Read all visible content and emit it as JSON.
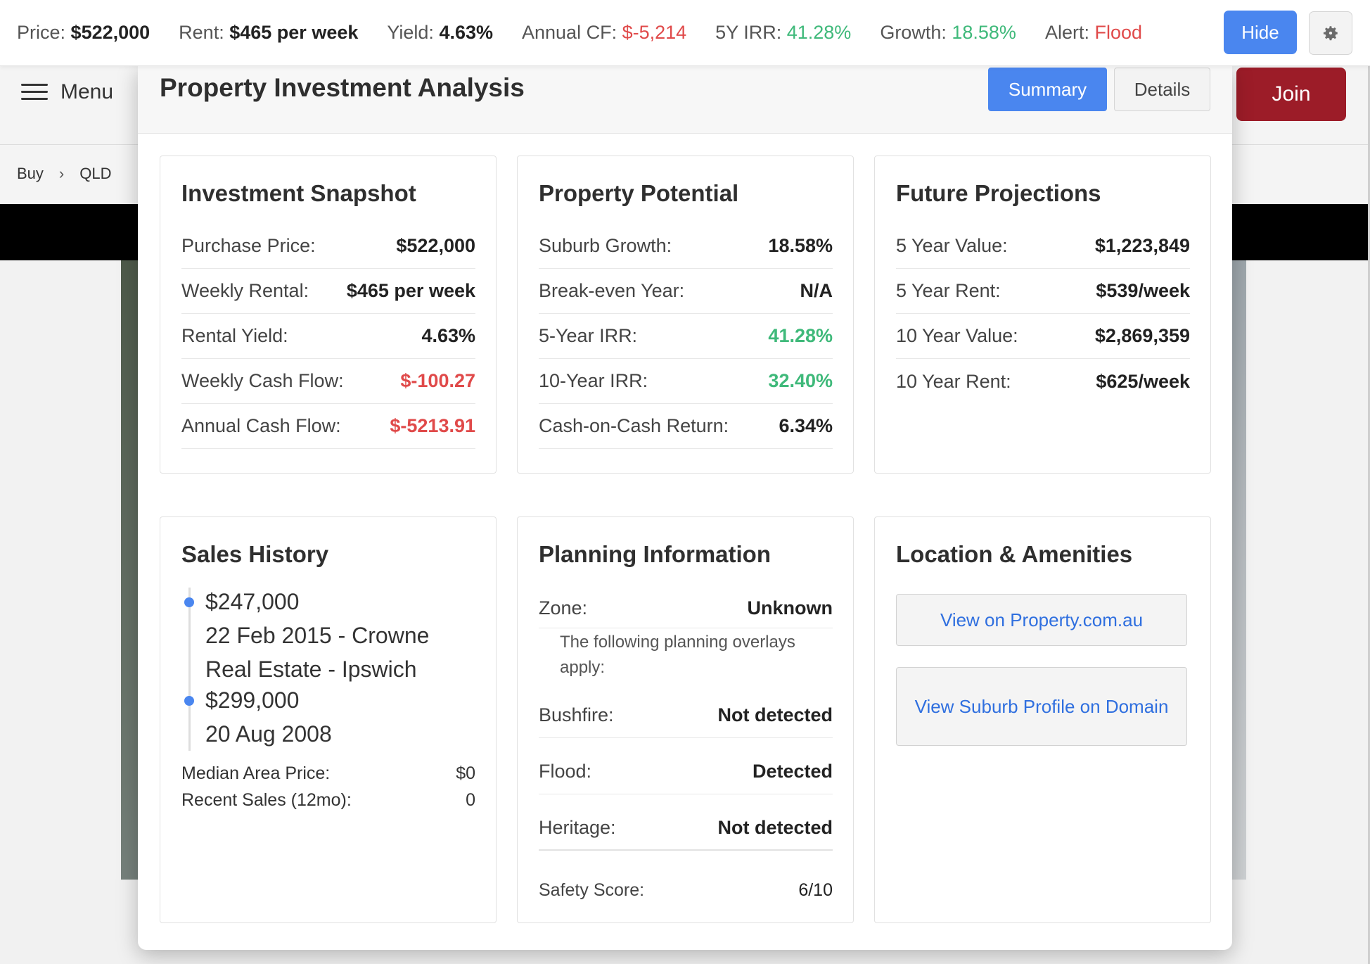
{
  "topbar": {
    "price_label": "Price:",
    "price": "$522,000",
    "rent_label": "Rent:",
    "rent": "$465 per week",
    "yield_label": "Yield:",
    "yield": "4.63%",
    "cf_label": "Annual CF:",
    "cf": "$-5,214",
    "irr_label": "5Y IRR:",
    "irr": "41.28%",
    "growth_label": "Growth:",
    "growth": "18.58%",
    "alert_label": "Alert:",
    "alert": "Flood",
    "hide_label": "Hide"
  },
  "background": {
    "menu_label": "Menu",
    "join_label": "Join",
    "breadcrumbs": [
      "Buy",
      "QLD"
    ]
  },
  "modal": {
    "title": "Property Investment Analysis",
    "tabs": {
      "summary": "Summary",
      "details": "Details"
    },
    "snapshot": {
      "title": "Investment Snapshot",
      "rows": [
        {
          "label": "Purchase Price:",
          "value": "$522,000"
        },
        {
          "label": "Weekly Rental:",
          "value": "$465 per week"
        },
        {
          "label": "Rental Yield:",
          "value": "4.63%"
        },
        {
          "label": "Weekly Cash Flow:",
          "value": "$-100.27"
        },
        {
          "label": "Annual Cash Flow:",
          "value": "$-5213.91"
        }
      ]
    },
    "potential": {
      "title": "Property Potential",
      "rows": [
        {
          "label": "Suburb Growth:",
          "value": "18.58%"
        },
        {
          "label": "Break-even Year:",
          "value": "N/A"
        },
        {
          "label": "5-Year IRR:",
          "value": "41.28%"
        },
        {
          "label": "10-Year IRR:",
          "value": "32.40%"
        },
        {
          "label": "Cash-on-Cash Return:",
          "value": "6.34%"
        }
      ]
    },
    "projections": {
      "title": "Future Projections",
      "rows": [
        {
          "label": "5 Year Value:",
          "value": "$1,223,849"
        },
        {
          "label": "5 Year Rent:",
          "value": "$539/week"
        },
        {
          "label": "10 Year Value:",
          "value": "$2,869,359"
        },
        {
          "label": "10 Year Rent:",
          "value": "$625/week"
        }
      ]
    },
    "sales": {
      "title": "Sales History",
      "items": [
        {
          "price": "$247,000",
          "detail": "22 Feb 2015 - Crowne Real Estate - Ipswich"
        },
        {
          "price": "$299,000",
          "detail": "20 Aug 2008"
        }
      ],
      "median_label": "Median Area Price:",
      "median_value": "$0",
      "recent_label": "Recent Sales (12mo):",
      "recent_value": "0"
    },
    "planning": {
      "title": "Planning Information",
      "zone_label": "Zone:",
      "zone_value": "Unknown",
      "overlay_note": "The following planning overlays apply:",
      "bushfire_label": "Bushfire:",
      "bushfire_value": "Not detected",
      "flood_label": "Flood:",
      "flood_value": "Detected",
      "heritage_label": "Heritage:",
      "heritage_value": "Not detected",
      "safety_label": "Safety Score:",
      "safety_value": "6/10"
    },
    "location": {
      "title": "Location & Amenities",
      "link1": "View on Property.com.au",
      "link2": "View Suburb Profile on Domain"
    }
  },
  "colors": {
    "accent": "#4a86ef",
    "negative": "#e04a4a",
    "positive": "#3fb97a",
    "join": "#9c1c28"
  }
}
